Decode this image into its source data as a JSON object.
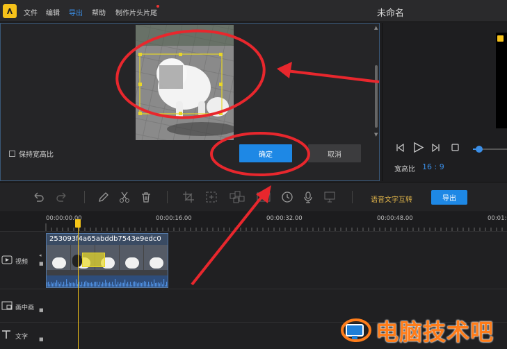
{
  "app": {
    "window_title": "未命名",
    "menus": [
      {
        "label": "文件",
        "active": false
      },
      {
        "label": "编辑",
        "active": false
      },
      {
        "label": "导出",
        "active": true
      },
      {
        "label": "帮助",
        "active": false
      },
      {
        "label": "制作片头片尾",
        "active": false
      }
    ]
  },
  "crop_dialog": {
    "keep_ratio_label": "保持宽高比",
    "keep_ratio_checked": false,
    "confirm_label": "确定",
    "cancel_label": "取消"
  },
  "preview": {
    "aspect_label": "宽高比",
    "aspect_value": "16 : 9",
    "volume_level": 0.1
  },
  "toolbar": {
    "speech_to_text_label": "语音文字互转",
    "export_label": "导出",
    "icons": [
      "undo-icon",
      "redo-icon",
      "pencil-icon",
      "scissors-icon",
      "trash-icon",
      "crop-icon",
      "zoom-icon",
      "mosaic-icon",
      "freeze-frame-icon",
      "duration-icon",
      "microphone-icon",
      "screen-record-icon"
    ]
  },
  "timeline": {
    "ruler_labels": [
      "00:00:00.00",
      "00:00:16.00",
      "00:00:32.00",
      "00:00:48.00",
      "00:01:0"
    ],
    "tracks": [
      {
        "label": "视频"
      },
      {
        "label": "画中画"
      },
      {
        "label": "文字"
      }
    ],
    "clip_name": "253093f4a65abddb7543e9edc0"
  },
  "watermark": {
    "text": "电脑技术吧"
  },
  "colors": {
    "accent": "#1e88e5",
    "annotation": "#e8272d",
    "playhead": "#f5c518",
    "crop_box": "#e8d628"
  }
}
